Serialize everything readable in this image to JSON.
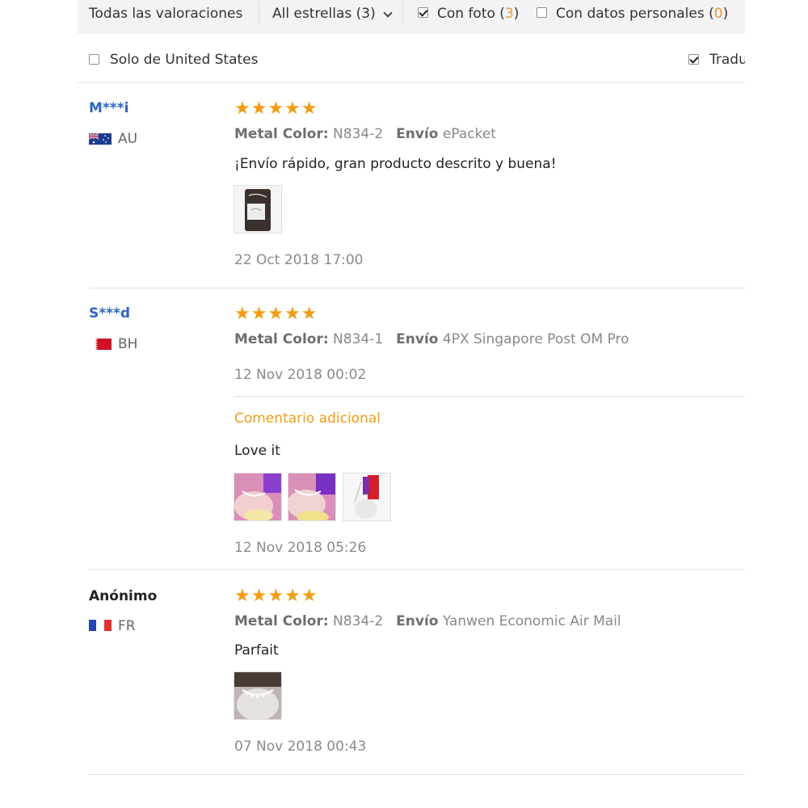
{
  "filter_bar": {
    "all_ratings": "Todas las valoraciones",
    "stars_select": "All estrellas (3)",
    "with_photo_label": "Con foto (",
    "with_photo_count": "3",
    "with_photo_close": ")",
    "with_photo_checked": true,
    "personal_label": "Con datos personales (",
    "personal_count": "0",
    "personal_close": ")",
    "personal_checked": false
  },
  "sub_row": {
    "only_country": "Solo de United States",
    "only_country_checked": false,
    "translate": "Tradu",
    "translate_checked": true
  },
  "labels": {
    "metal_color": "Metal Color:",
    "shipping": "Envío",
    "additional_comment": "Comentario adicional"
  },
  "colors": {
    "accent_orange": "#f39c12",
    "user_blue": "#2c63c4",
    "filter_bg": "#f3f3f3"
  },
  "reviews": [
    {
      "user": "M***i",
      "country": "AU",
      "flag": "flag-au-icon",
      "rating": 5,
      "stars": "★★★★★",
      "metal_color": "N834-2",
      "shipping": "ePacket",
      "comment": "¡Envío rápido, gran producto descrito y buena!",
      "photos": [
        "photo-1"
      ],
      "date": "22 Oct 2018 17:00"
    },
    {
      "user": "S***d",
      "country": "BH",
      "flag": "flag-bh-icon",
      "rating": 5,
      "stars": "★★★★★",
      "metal_color": "N834-1",
      "shipping": "4PX Singapore Post OM Pro",
      "date": "12 Nov 2018 00:02",
      "additional": {
        "comment": "Love it",
        "photos": [
          "photo-1",
          "photo-2",
          "photo-3"
        ],
        "date": "12 Nov 2018 05:26"
      }
    },
    {
      "user": "Anónimo",
      "country": "FR",
      "flag": "flag-fr-icon",
      "rating": 5,
      "stars": "★★★★★",
      "metal_color": "N834-2",
      "shipping": "Yanwen Economic Air Mail",
      "comment": "Parfait",
      "photos": [
        "photo-1"
      ],
      "date": "07 Nov 2018 00:43"
    }
  ]
}
